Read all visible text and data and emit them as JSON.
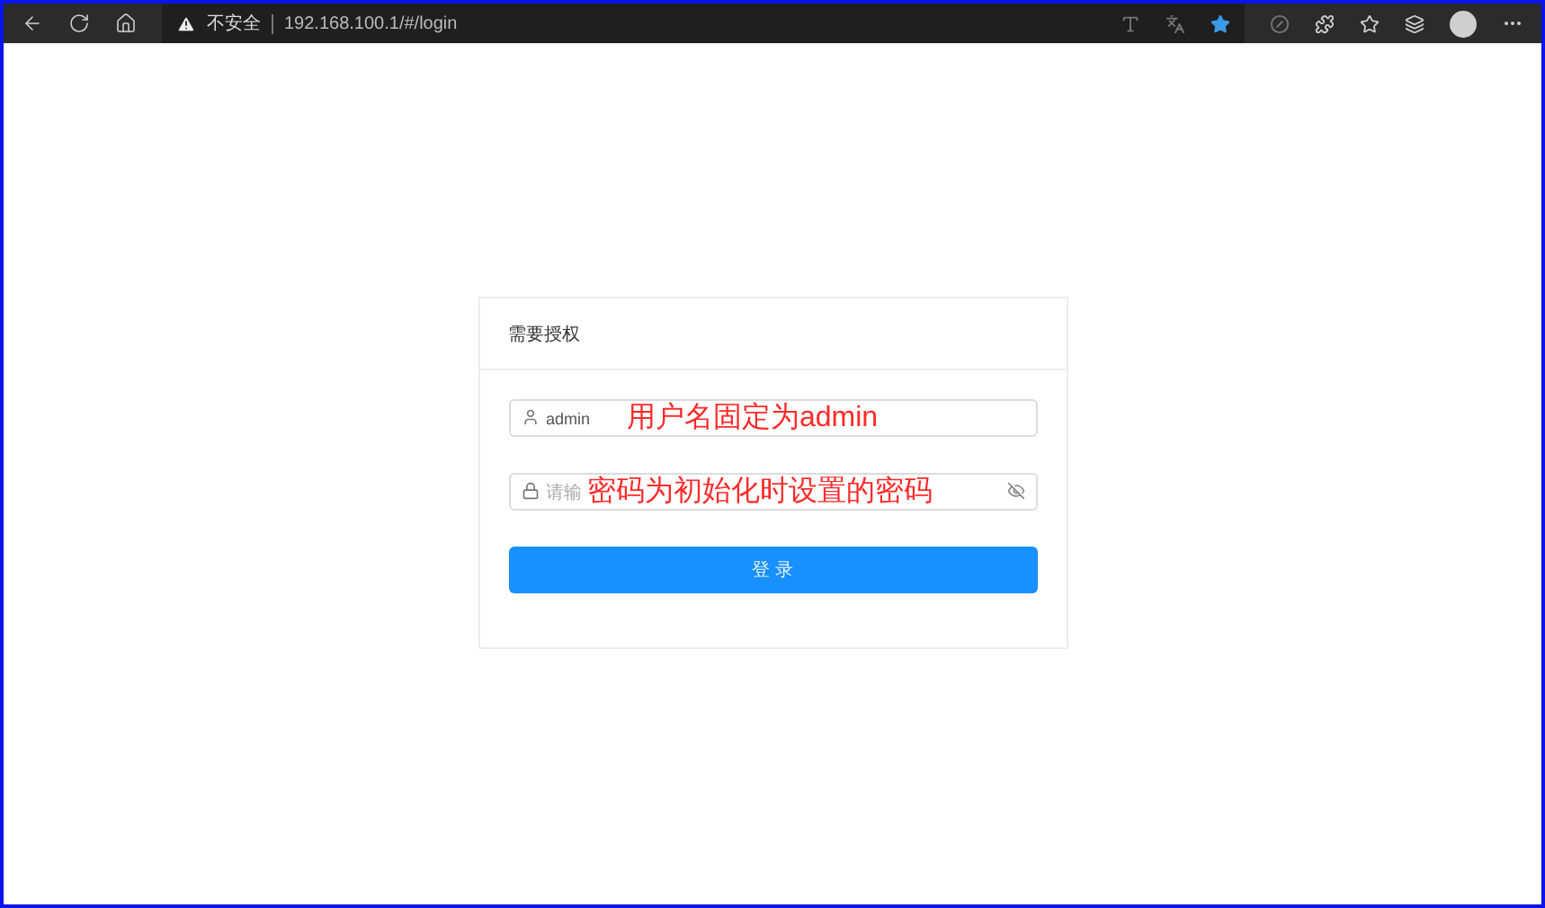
{
  "browser": {
    "security_label": "不安全",
    "url": "192.168.100.1/#/login"
  },
  "card": {
    "title": "需要授权",
    "username": {
      "value": "admin",
      "note": "用户名固定为admin"
    },
    "password": {
      "placeholder": "请输",
      "note": "密码为初始化时设置的密码"
    },
    "login_button": "登 录"
  }
}
